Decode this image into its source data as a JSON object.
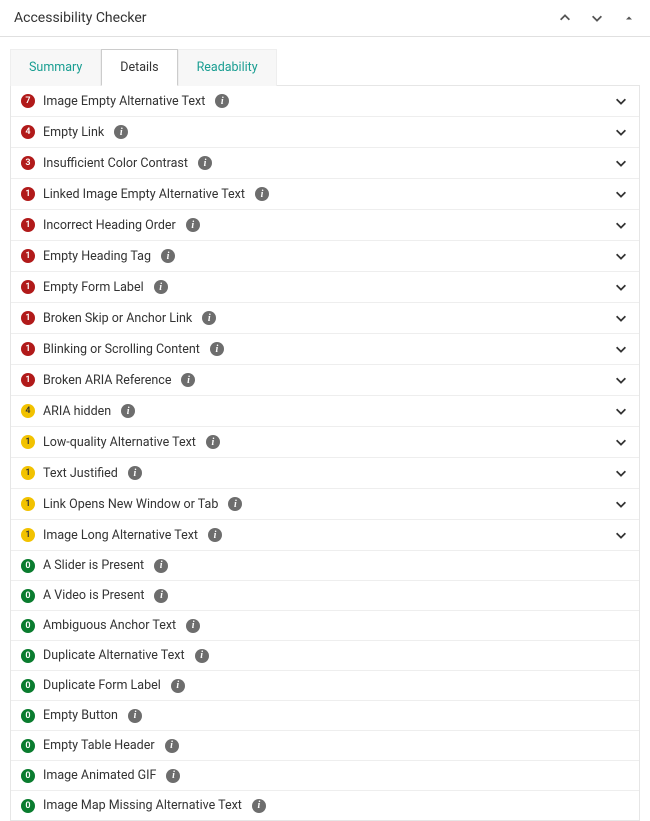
{
  "header": {
    "title": "Accessibility Checker"
  },
  "tabs": [
    {
      "label": "Summary",
      "active": false
    },
    {
      "label": "Details",
      "active": true
    },
    {
      "label": "Readability",
      "active": false
    }
  ],
  "issues": [
    {
      "count": 7,
      "severity": "red",
      "label": "Image Empty Alternative Text",
      "expandable": true
    },
    {
      "count": 4,
      "severity": "red",
      "label": "Empty Link",
      "expandable": true
    },
    {
      "count": 3,
      "severity": "red",
      "label": "Insufficient Color Contrast",
      "expandable": true
    },
    {
      "count": 1,
      "severity": "red",
      "label": "Linked Image Empty Alternative Text",
      "expandable": true
    },
    {
      "count": 1,
      "severity": "red",
      "label": "Incorrect Heading Order",
      "expandable": true
    },
    {
      "count": 1,
      "severity": "red",
      "label": "Empty Heading Tag",
      "expandable": true
    },
    {
      "count": 1,
      "severity": "red",
      "label": "Empty Form Label",
      "expandable": true
    },
    {
      "count": 1,
      "severity": "red",
      "label": "Broken Skip or Anchor Link",
      "expandable": true
    },
    {
      "count": 1,
      "severity": "red",
      "label": "Blinking or Scrolling Content",
      "expandable": true
    },
    {
      "count": 1,
      "severity": "red",
      "label": "Broken ARIA Reference",
      "expandable": true
    },
    {
      "count": 4,
      "severity": "yellow",
      "label": "ARIA hidden",
      "expandable": true
    },
    {
      "count": 1,
      "severity": "yellow",
      "label": "Low-quality Alternative Text",
      "expandable": true
    },
    {
      "count": 1,
      "severity": "yellow",
      "label": "Text Justified",
      "expandable": true
    },
    {
      "count": 1,
      "severity": "yellow",
      "label": "Link Opens New Window or Tab",
      "expandable": true
    },
    {
      "count": 1,
      "severity": "yellow",
      "label": "Image Long Alternative Text",
      "expandable": true
    },
    {
      "count": 0,
      "severity": "green",
      "label": "A Slider is Present",
      "expandable": false
    },
    {
      "count": 0,
      "severity": "green",
      "label": "A Video is Present",
      "expandable": false
    },
    {
      "count": 0,
      "severity": "green",
      "label": "Ambiguous Anchor Text",
      "expandable": false
    },
    {
      "count": 0,
      "severity": "green",
      "label": "Duplicate Alternative Text",
      "expandable": false
    },
    {
      "count": 0,
      "severity": "green",
      "label": "Duplicate Form Label",
      "expandable": false
    },
    {
      "count": 0,
      "severity": "green",
      "label": "Empty Button",
      "expandable": false
    },
    {
      "count": 0,
      "severity": "green",
      "label": "Empty Table Header",
      "expandable": false
    },
    {
      "count": 0,
      "severity": "green",
      "label": "Image Animated GIF",
      "expandable": false
    },
    {
      "count": 0,
      "severity": "green",
      "label": "Image Map Missing Alternative Text",
      "expandable": false
    }
  ]
}
